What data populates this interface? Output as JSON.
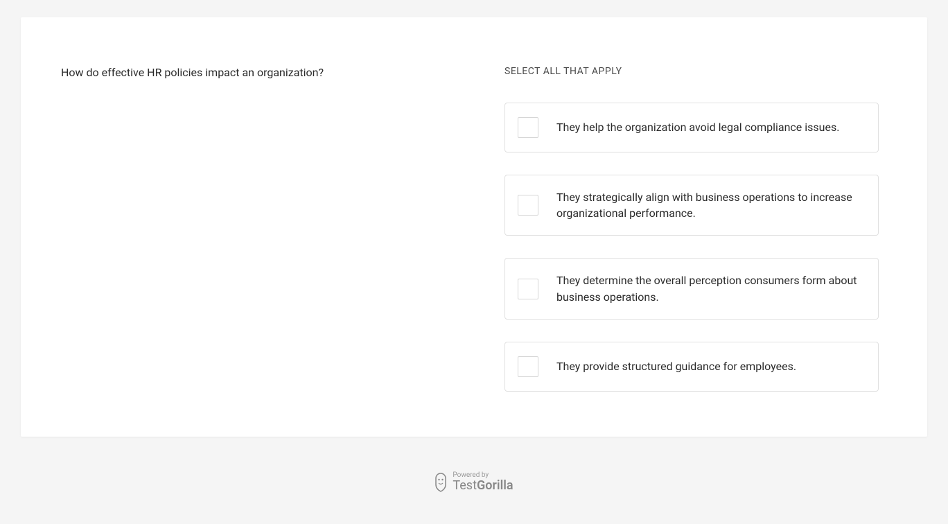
{
  "question": {
    "text": "How do effective HR policies impact an organization?",
    "instruction": "SELECT ALL THAT APPLY"
  },
  "options": [
    {
      "text": "They help the organization avoid legal compliance issues."
    },
    {
      "text": "They strategically align with business operations to increase organizational performance."
    },
    {
      "text": "They determine the overall perception consumers form about business operations."
    },
    {
      "text": "They provide structured guidance for employees."
    }
  ],
  "footer": {
    "powered_by": "Powered by",
    "brand_part1": "Test",
    "brand_part2": "Gorilla"
  }
}
